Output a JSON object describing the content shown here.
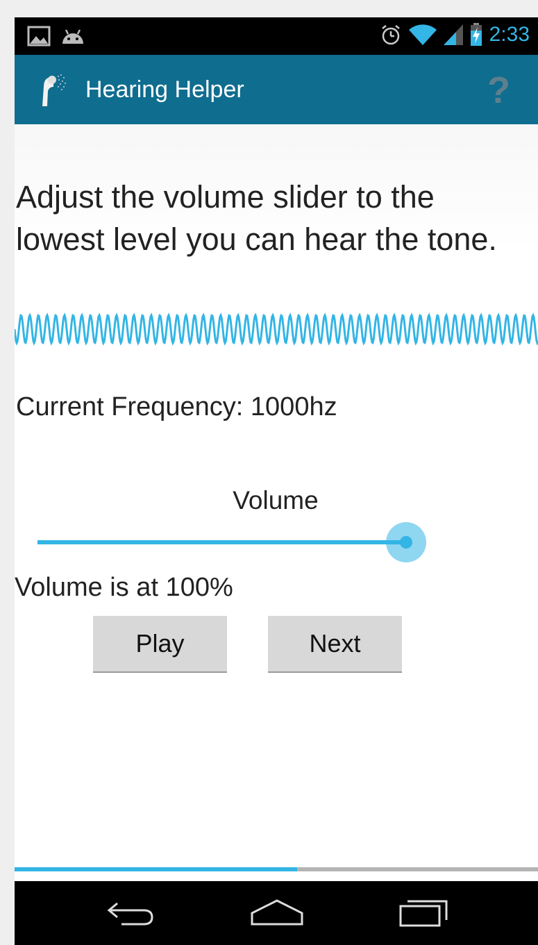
{
  "status_bar": {
    "time": "2:33",
    "left_icons": [
      "picture-icon",
      "android-icon"
    ],
    "right_icons": [
      "alarm-icon",
      "wifi-icon",
      "signal-icon",
      "battery-charging-icon"
    ]
  },
  "action_bar": {
    "title": "Hearing Helper",
    "help_label": "?",
    "color": "#0f6d8f"
  },
  "main": {
    "instruction": "Adjust the volume slider to the lowest level you can hear the tone.",
    "frequency_text": "Current Frequency: 1000hz",
    "volume_label": "Volume",
    "volume_percent": 100,
    "volume_status": "Volume is at 100%",
    "play_label": "Play",
    "next_label": "Next",
    "progress_fraction": 0.54
  },
  "colors": {
    "accent": "#33b5e5",
    "text": "#222222"
  },
  "nav_bar": {
    "buttons": [
      "back-icon",
      "home-icon",
      "recent-apps-icon"
    ]
  }
}
